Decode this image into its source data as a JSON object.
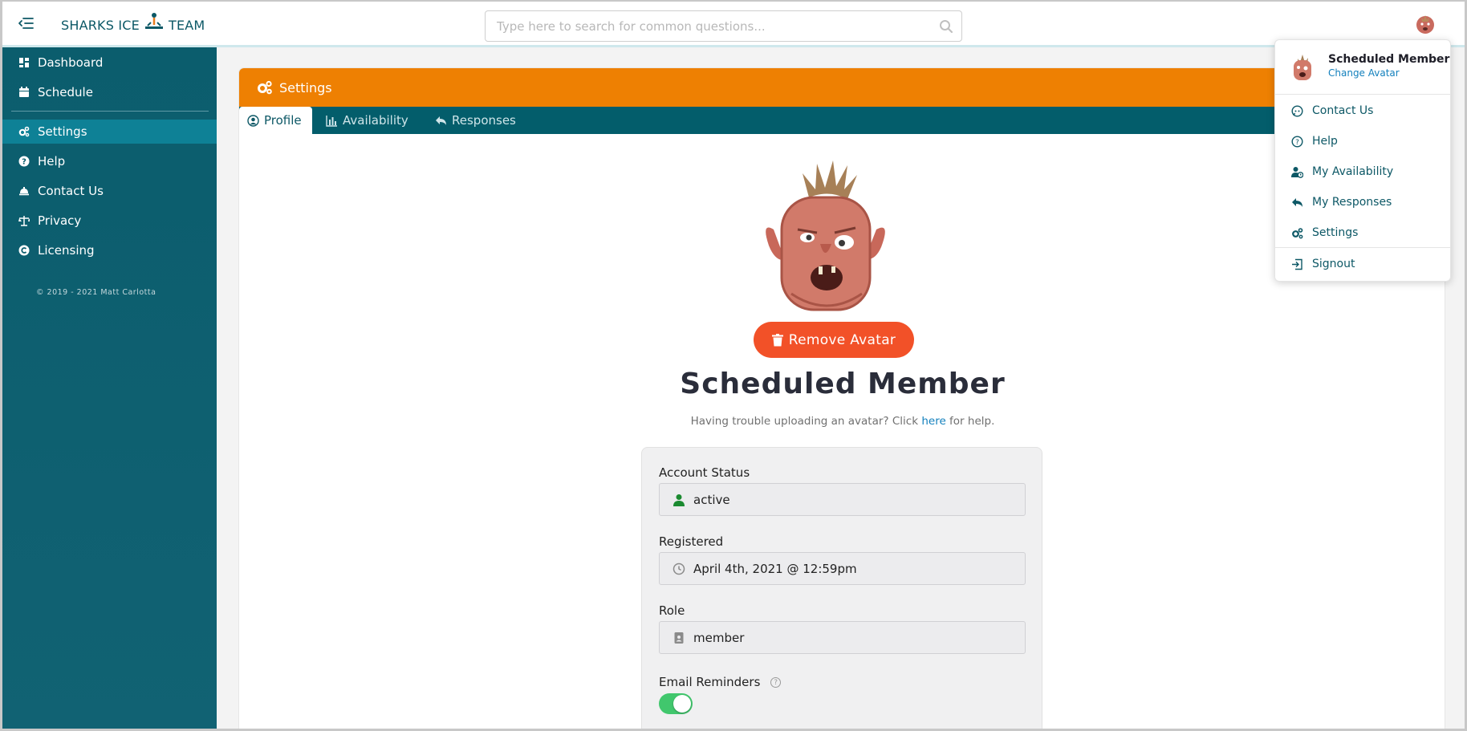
{
  "header": {
    "brand_left": "SHARKS ICE",
    "brand_right": "TEAM",
    "search_placeholder": "Type here to search for common questions..."
  },
  "sidebar": {
    "items": [
      {
        "label": "Dashboard",
        "icon": "dashboard-icon"
      },
      {
        "label": "Schedule",
        "icon": "calendar-icon"
      },
      {
        "label": "Settings",
        "icon": "gears-icon",
        "active": true
      },
      {
        "label": "Help",
        "icon": "question-circle-icon"
      },
      {
        "label": "Contact Us",
        "icon": "bell-icon"
      },
      {
        "label": "Privacy",
        "icon": "balance-scale-icon"
      },
      {
        "label": "Licensing",
        "icon": "copyright-icon"
      }
    ],
    "copyright": "© 2019 - 2021 Matt Carlotta"
  },
  "card": {
    "title": "Settings",
    "tabs": [
      {
        "label": "Profile",
        "active": true
      },
      {
        "label": "Availability"
      },
      {
        "label": "Responses"
      }
    ]
  },
  "profile": {
    "remove_avatar_label": "Remove Avatar",
    "name": "Scheduled Member",
    "help_prefix": "Having trouble uploading an avatar? Click",
    "help_link": "here",
    "help_suffix": "for help."
  },
  "form": {
    "account_status_label": "Account Status",
    "account_status_value": "active",
    "registered_label": "Registered",
    "registered_value": "April 4th, 2021 @ 12:59pm",
    "role_label": "Role",
    "role_value": "member",
    "email_reminders_label": "Email Reminders",
    "email_reminders_on": true
  },
  "dropdown": {
    "name": "Scheduled Member",
    "change_avatar": "Change Avatar",
    "items": [
      {
        "label": "Contact Us",
        "icon": "chat-icon"
      },
      {
        "label": "Help",
        "icon": "question-circle-icon"
      },
      {
        "label": "My Availability",
        "icon": "user-clock-icon"
      },
      {
        "label": "My Responses",
        "icon": "reply-icon"
      },
      {
        "label": "Settings",
        "icon": "gears-icon"
      }
    ],
    "signout": "Signout"
  },
  "colors": {
    "sidebar": "#0b5d6d",
    "accent_orange": "#ee8002",
    "tab_bar": "#035d6b",
    "danger": "#f25128",
    "toggle_on": "#41c76d",
    "link": "#1380bd"
  }
}
